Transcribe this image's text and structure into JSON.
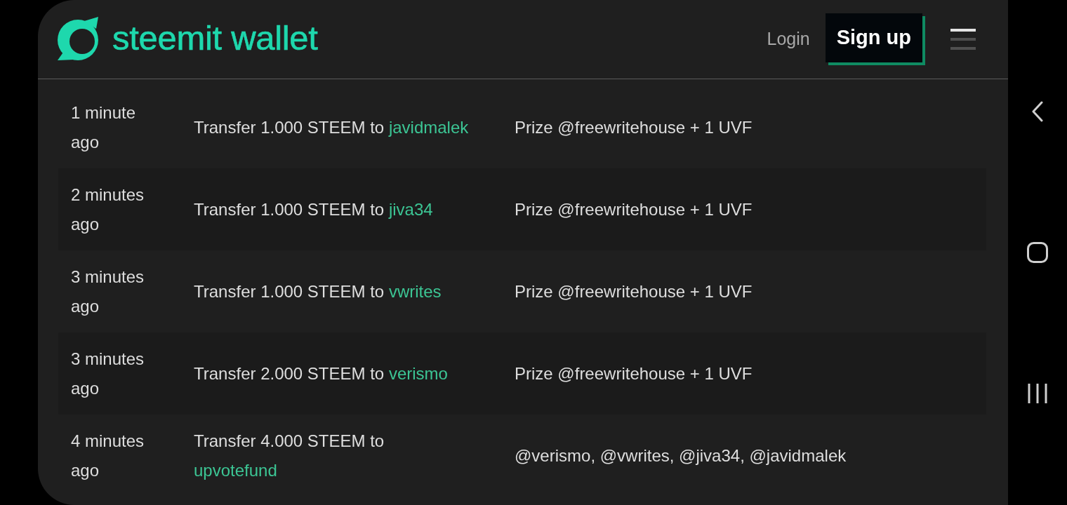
{
  "header": {
    "brand": "steemit wallet",
    "login": "Login",
    "signup": "Sign up"
  },
  "transfers": [
    {
      "time": "1 minute ago",
      "action": "Transfer 1.000 STEEM to",
      "recipient": "javidmalek",
      "memo": "Prize @freewritehouse + 1 UVF"
    },
    {
      "time": "2 minutes ago",
      "action": "Transfer 1.000 STEEM to",
      "recipient": "jiva34",
      "memo": "Prize @freewritehouse + 1 UVF"
    },
    {
      "time": "3 minutes ago",
      "action": "Transfer 1.000 STEEM to",
      "recipient": "vwrites",
      "memo": "Prize @freewritehouse + 1 UVF"
    },
    {
      "time": "3 minutes ago",
      "action": "Transfer 2.000 STEEM to",
      "recipient": "verismo",
      "memo": "Prize @freewritehouse + 1 UVF"
    },
    {
      "time": "4 minutes ago",
      "action": "Transfer 4.000 STEEM to",
      "recipient": "upvotefund",
      "memo": "@verismo, @vwrites, @jiva34, @javidmalek"
    }
  ]
}
